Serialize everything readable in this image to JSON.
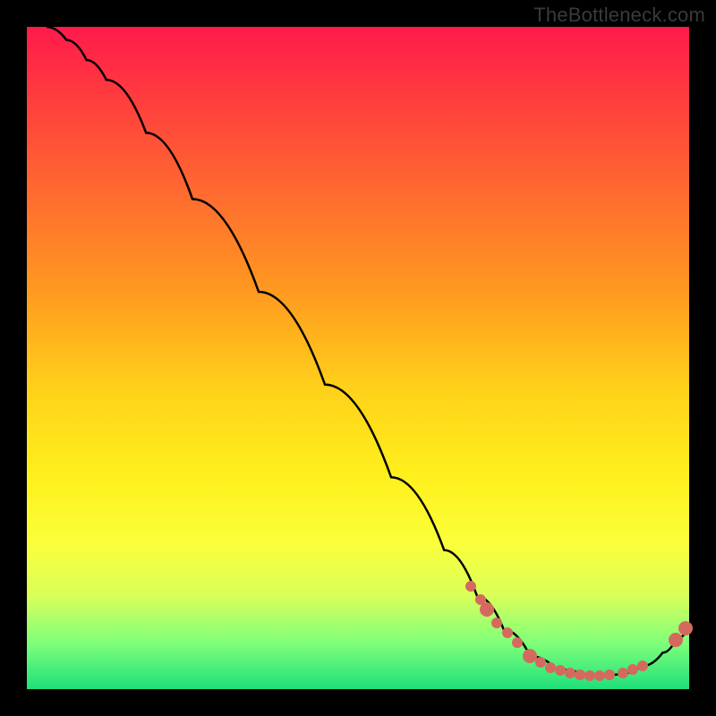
{
  "watermark": "TheBottleneck.com",
  "colors": {
    "gradient_top": "#ff1a4b",
    "gradient_bottom": "#1fe07a",
    "curve": "#000000",
    "dot": "#d46a5e",
    "frame": "#000000"
  },
  "annotation": {
    "text": "",
    "visible": false
  },
  "chart_data": {
    "type": "line",
    "title": "",
    "xlabel": "",
    "ylabel": "",
    "xlim": [
      0,
      100
    ],
    "ylim": [
      0,
      100
    ],
    "grid": false,
    "curve": [
      {
        "x": 3,
        "y": 100
      },
      {
        "x": 6,
        "y": 98
      },
      {
        "x": 9,
        "y": 95
      },
      {
        "x": 12,
        "y": 92
      },
      {
        "x": 18,
        "y": 84
      },
      {
        "x": 25,
        "y": 74
      },
      {
        "x": 35,
        "y": 60
      },
      {
        "x": 45,
        "y": 46
      },
      {
        "x": 55,
        "y": 32
      },
      {
        "x": 63,
        "y": 21
      },
      {
        "x": 68,
        "y": 14
      },
      {
        "x": 72,
        "y": 9
      },
      {
        "x": 76,
        "y": 5
      },
      {
        "x": 80,
        "y": 3
      },
      {
        "x": 85,
        "y": 2
      },
      {
        "x": 89,
        "y": 2.2
      },
      {
        "x": 93,
        "y": 3.5
      },
      {
        "x": 96,
        "y": 5.5
      },
      {
        "x": 98,
        "y": 7.5
      },
      {
        "x": 100,
        "y": 9.5
      }
    ],
    "highlight_points": [
      {
        "x": 67,
        "y": 15.5,
        "size": "small"
      },
      {
        "x": 68.5,
        "y": 13.5,
        "size": "small"
      },
      {
        "x": 69.5,
        "y": 12,
        "size": "big"
      },
      {
        "x": 71,
        "y": 10,
        "size": "small"
      },
      {
        "x": 72.5,
        "y": 8.5,
        "size": "small"
      },
      {
        "x": 74,
        "y": 7,
        "size": "small"
      },
      {
        "x": 76,
        "y": 5,
        "size": "big"
      },
      {
        "x": 77.5,
        "y": 4,
        "size": "small"
      },
      {
        "x": 79,
        "y": 3.2,
        "size": "small"
      },
      {
        "x": 80.5,
        "y": 2.8,
        "size": "small"
      },
      {
        "x": 82,
        "y": 2.4,
        "size": "small"
      },
      {
        "x": 83.5,
        "y": 2.2,
        "size": "small"
      },
      {
        "x": 85,
        "y": 2,
        "size": "small"
      },
      {
        "x": 86.5,
        "y": 2,
        "size": "small"
      },
      {
        "x": 88,
        "y": 2.1,
        "size": "small"
      },
      {
        "x": 90,
        "y": 2.5,
        "size": "small"
      },
      {
        "x": 91.5,
        "y": 3,
        "size": "small"
      },
      {
        "x": 93,
        "y": 3.5,
        "size": "small"
      },
      {
        "x": 98,
        "y": 7.5,
        "size": "big"
      },
      {
        "x": 99.5,
        "y": 9.2,
        "size": "big"
      }
    ]
  }
}
